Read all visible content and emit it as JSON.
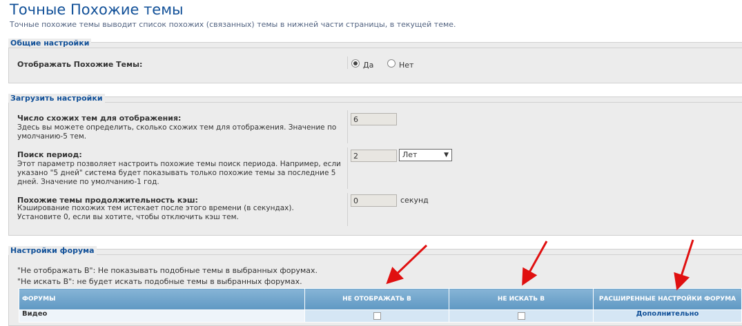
{
  "page": {
    "title": "Точные Похожие темы",
    "description": "Точные похожие темы выводит список похожих (связанных) темы в нижней части страницы, в текущей теме."
  },
  "general": {
    "legend": "Общие настройки",
    "display_label": "Отображать Похожие Темы:",
    "yes_label": "Да",
    "no_label": "Нет",
    "selected": "yes"
  },
  "load": {
    "legend": "Загрузить настройки",
    "count": {
      "title": "Число схожих тем для отображения:",
      "desc": "Здесь вы можете определить, сколько схожих тем для отображения. Значение по умолчанию-5 тем.",
      "value": "6"
    },
    "period": {
      "title": "Поиск период:",
      "desc": "Этот параметр позволяет настроить похожие темы поиск периода. Например, если указано \"5 дней\" система будет показывать только похожие темы за последние 5 дней. Значение по умолчанию-1 год.",
      "value": "2",
      "unit_selected": "Лет"
    },
    "cache": {
      "title": "Похожие темы продолжительность кэш:",
      "desc": "Кэширование похожих тем истекает после этого времени (в секундах). Установите 0, если вы хотите, чтобы отключить кэш тем.",
      "value": "0",
      "unit": "секунд"
    }
  },
  "forum": {
    "legend": "Настройки форума",
    "note1": "\"Не отображать В\": Не показывать подобные темы в выбранных форумах.",
    "note2": "\"Не искать В\": не будет искать подобные темы в выбранных форумах.",
    "columns": [
      "ФОРУМЫ",
      "НЕ ОТОБРАЖАТЬ В",
      "НЕ ИСКАТЬ В",
      "РАСШИРЕННЫЕ НАСТРОЙКИ ФОРУМА"
    ],
    "rows": [
      {
        "name": "Видео",
        "action": "Дополнительно"
      }
    ]
  },
  "colors": {
    "title": "#115098",
    "header_bg": "#6aa1c9",
    "arrow": "#e01010"
  }
}
